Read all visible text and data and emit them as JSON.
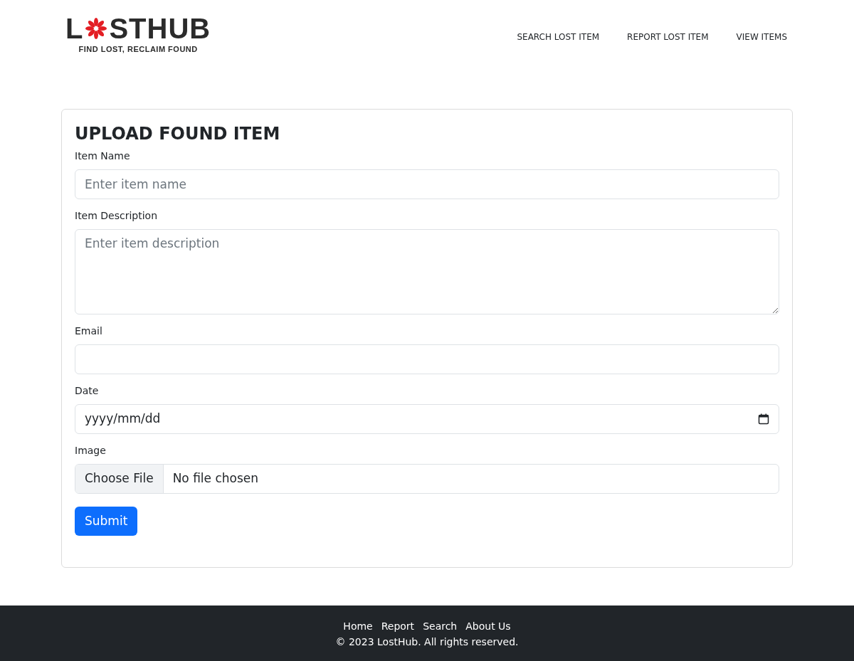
{
  "logo": {
    "before": "L",
    "after": "STHUB",
    "tagline": "FIND LOST, RECLAIM FOUND"
  },
  "nav": [
    "SEARCH LOST ITEM",
    "REPORT LOST ITEM",
    "VIEW ITEMS"
  ],
  "form": {
    "title": "UPLOAD FOUND ITEM",
    "fields": [
      {
        "kind": "text",
        "label": "Item Name",
        "placeholder": "Enter item name"
      },
      {
        "kind": "textarea",
        "label": "Item Description",
        "placeholder": "Enter item description"
      },
      {
        "kind": "email",
        "label": "Email"
      },
      {
        "kind": "date",
        "label": "Date",
        "value": "yyyy/mm/dd"
      },
      {
        "kind": "file",
        "label": "Image",
        "button": "Choose File",
        "value": "No file chosen"
      }
    ],
    "submit": "Submit"
  },
  "footer": {
    "links": [
      "Home",
      "Report",
      "Search",
      "About Us"
    ],
    "copyright": "© 2023 LostHub. All rights reserved."
  }
}
